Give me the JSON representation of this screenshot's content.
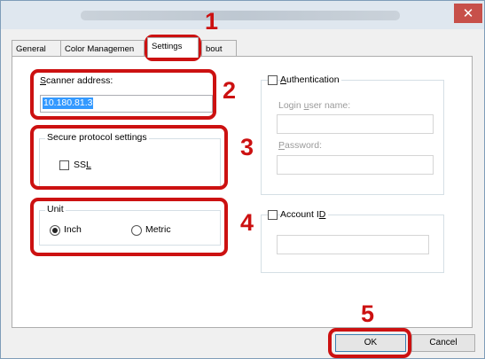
{
  "window": {
    "close_glyph": "✕"
  },
  "tabs": [
    {
      "label": "General"
    },
    {
      "label": "Color Managemen"
    },
    {
      "label": "Settings",
      "active": true
    },
    {
      "label": "bout"
    }
  ],
  "scanner": {
    "label_first": "S",
    "label_rest": "canner address:",
    "address": "10.180.81.3"
  },
  "secure": {
    "title": "Secure protocol settings",
    "ssl_label_main": "SS",
    "ssl_label_underlined": "L",
    "ssl_checked": false
  },
  "unit": {
    "title": "Unit",
    "options": [
      {
        "label": "Inch",
        "selected": true
      },
      {
        "label": "Metric",
        "selected": false
      }
    ]
  },
  "authentication": {
    "label_first": "A",
    "label_rest": "uthentication",
    "checked": false,
    "login_label_pre": "Login ",
    "login_label_u": "u",
    "login_label_post": "ser name:",
    "login_value": "",
    "password_label_first": "P",
    "password_label_rest": "assword:",
    "password_value": ""
  },
  "account": {
    "label_pre": "Account I",
    "label_u": "D",
    "checked": false,
    "value": ""
  },
  "buttons": {
    "ok": "OK",
    "cancel": "Cancel"
  },
  "callouts": [
    "1",
    "2",
    "3",
    "4",
    "5"
  ],
  "colors": {
    "highlight": "#cc1111",
    "selection": "#3399ff",
    "close_button": "#c7504a"
  }
}
